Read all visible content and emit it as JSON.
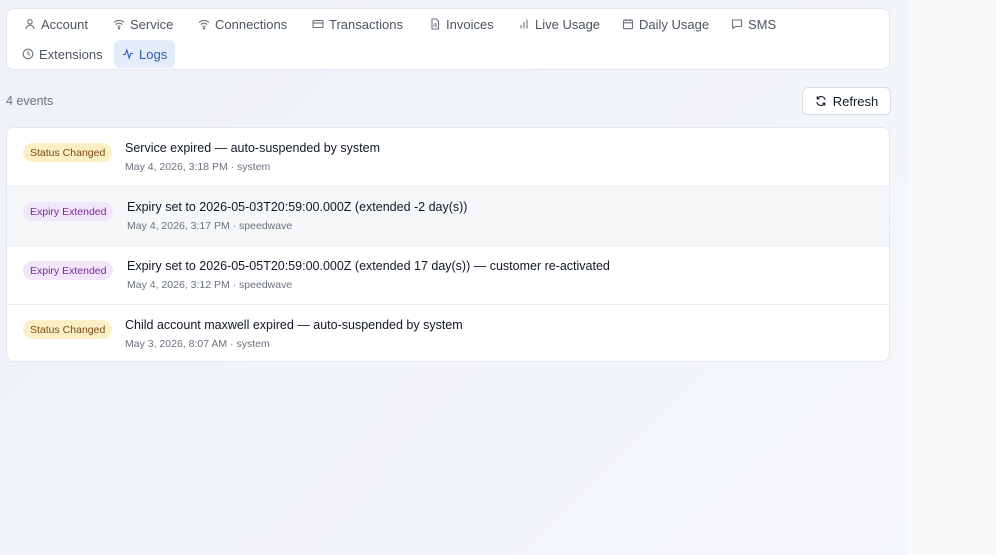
{
  "tabs": [
    {
      "label": "Account",
      "icon": "user-icon"
    },
    {
      "label": "Service",
      "icon": "wifi-icon"
    },
    {
      "label": "Connections",
      "icon": "wifi-icon"
    },
    {
      "label": "Transactions",
      "icon": "credit-card-icon"
    },
    {
      "label": "Invoices",
      "icon": "file-icon"
    },
    {
      "label": "Live Usage",
      "icon": "bar-chart-icon"
    },
    {
      "label": "Daily Usage",
      "icon": "calendar-icon"
    },
    {
      "label": "SMS",
      "icon": "message-icon"
    },
    {
      "label": "Extensions",
      "icon": "clock-icon"
    },
    {
      "label": "Logs",
      "icon": "activity-icon",
      "active": true
    }
  ],
  "toolbar": {
    "events_count": "4 events",
    "refresh_label": "Refresh"
  },
  "logs": [
    {
      "badge": "Status Changed",
      "message": "Service expired — auto-suspended by system",
      "meta": "May 4, 2026, 3:18 PM · system"
    },
    {
      "badge": "Expiry Extended",
      "message": "Expiry set to 2026-05-03T20:59:00.000Z (extended -2 day(s))",
      "meta": "May 4, 2026, 3:17 PM · speedwave"
    },
    {
      "badge": "Expiry Extended",
      "message": "Expiry set to 2026-05-05T20:59:00.000Z (extended 17 day(s)) — customer re-activated",
      "meta": "May 4, 2026, 3:12 PM · speedwave"
    },
    {
      "badge": "Status Changed",
      "message": "Child account maxwell expired — auto-suspended by system",
      "meta": "May 3, 2026, 8:07 AM · system"
    }
  ],
  "colors": {
    "active_tab_bg": "#e4ecf9",
    "active_tab_text": "#2a5db0",
    "status_badge_bg": "#fcefc6",
    "expiry_badge_bg": "#f3e6fa"
  }
}
